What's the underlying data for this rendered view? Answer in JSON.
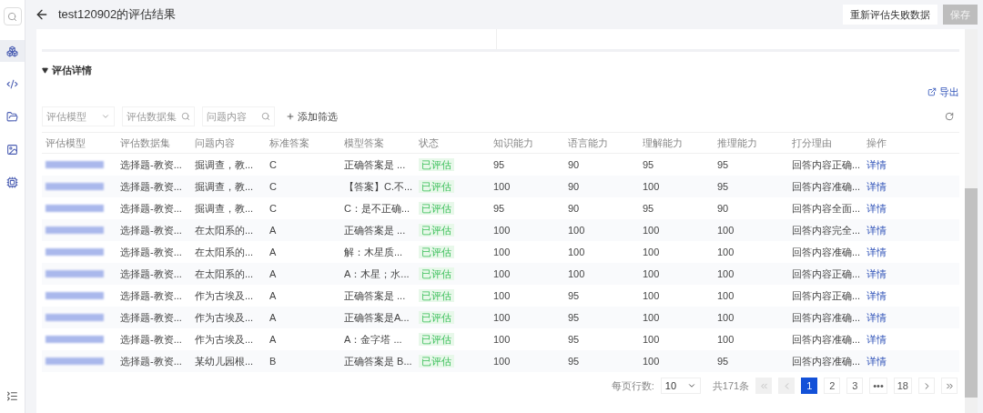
{
  "header": {
    "title": "test120902的评估结果",
    "buttons": [
      {
        "label": "重新评估失败数据",
        "disabled": false
      },
      {
        "label": "保存",
        "disabled": true
      }
    ]
  },
  "sidebar": {
    "items": [
      {
        "selected": true
      },
      {
        "selected": false
      },
      {
        "selected": false
      },
      {
        "selected": false
      },
      {
        "selected": false
      }
    ]
  },
  "section": {
    "title": "评估详情",
    "expanded": true,
    "export": "导出"
  },
  "filters": [
    {
      "kind": "select",
      "placeholder": "评估模型"
    },
    {
      "kind": "search",
      "placeholder": "评估数据集"
    },
    {
      "kind": "search",
      "placeholder": "问题内容"
    }
  ],
  "add_filter": "添加筛选",
  "table": {
    "columns": [
      "评估模型",
      "评估数据集",
      "问题内容",
      "标准答案",
      "模型答案",
      "状态",
      "知识能力",
      "语言能力",
      "理解能力",
      "推理能力",
      "打分理由",
      "操作"
    ],
    "rows": [
      {
        "cells": [
          "",
          "选择题-教资...",
          "掘调查，教...",
          "C",
          "正确答案是 ...",
          "已评估",
          "95",
          "90",
          "95",
          "95",
          "回答内容正确...",
          "详情"
        ]
      },
      {
        "cells": [
          "",
          "选择题-教资...",
          "掘调查，教...",
          "C",
          "【答案】C.不...",
          "已评估",
          "100",
          "90",
          "100",
          "95",
          "回答内容准确...",
          "详情"
        ]
      },
      {
        "cells": [
          "",
          "选择题-教资...",
          "掘调查，教...",
          "C",
          "C：是不正确...",
          "已评估",
          "95",
          "90",
          "95",
          "90",
          "回答内容全面...",
          "详情"
        ]
      },
      {
        "cells": [
          "",
          "选择题-教资...",
          "在太阳系的...",
          "A",
          "正确答案是 ...",
          "已评估",
          "100",
          "100",
          "100",
          "100",
          "回答内容完全...",
          "详情"
        ]
      },
      {
        "cells": [
          "",
          "选择题-教资...",
          "在太阳系的...",
          "A",
          "解：木星质...",
          "已评估",
          "100",
          "100",
          "100",
          "100",
          "回答内容准确...",
          "详情"
        ]
      },
      {
        "cells": [
          "",
          "选择题-教资...",
          "在太阳系的...",
          "A",
          "A：木星；水...",
          "已评估",
          "100",
          "100",
          "100",
          "100",
          "回答内容正确...",
          "详情"
        ]
      },
      {
        "cells": [
          "",
          "选择题-教资...",
          "作为古埃及...",
          "A",
          "正确答案是 ...",
          "已评估",
          "100",
          "95",
          "100",
          "100",
          "回答内容正确...",
          "详情"
        ]
      },
      {
        "cells": [
          "",
          "选择题-教资...",
          "作为古埃及...",
          "A",
          "正确答案是A...",
          "已评估",
          "100",
          "95",
          "100",
          "100",
          "回答内容准确...",
          "详情"
        ]
      },
      {
        "cells": [
          "",
          "选择题-教资...",
          "作为古埃及...",
          "A",
          "A：金字塔 ...",
          "已评估",
          "100",
          "95",
          "100",
          "100",
          "回答内容准确...",
          "详情"
        ]
      },
      {
        "cells": [
          "",
          "选择题-教资...",
          "某幼儿园根...",
          "B",
          "正确答案是 B...",
          "已评估",
          "100",
          "95",
          "100",
          "95",
          "回答内容准确...",
          "详情"
        ]
      }
    ]
  },
  "pagination": {
    "rows_label": "每页行数:",
    "rows_value": "10",
    "total": "共171条",
    "first_disabled": true,
    "prev_disabled": true,
    "pages": [
      {
        "label": "1",
        "selected": true
      },
      {
        "label": "2",
        "selected": false
      },
      {
        "label": "3",
        "selected": false
      },
      {
        "label": "•••",
        "selected": false
      },
      {
        "label": "18",
        "selected": false
      }
    ]
  }
}
